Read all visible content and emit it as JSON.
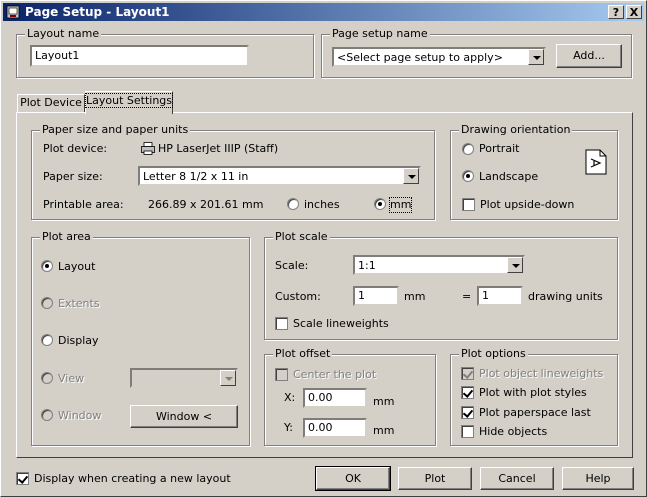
{
  "titlebar": {
    "title": "Page Setup - Layout1",
    "help_glyph": "?",
    "close_glyph": "X"
  },
  "layout_name": {
    "label": "Layout name",
    "value": "Layout1"
  },
  "page_setup_name": {
    "label": "Page setup name",
    "value": "<Select page setup to apply>",
    "add_button": "Add..."
  },
  "tabs": {
    "plot_device": "Plot Device",
    "layout_settings": "Layout Settings"
  },
  "paper": {
    "group_label": "Paper size and paper units",
    "plot_device_label": "Plot device:",
    "plot_device_value": "HP LaserJet IIIP (Staff)",
    "paper_size_label": "Paper size:",
    "paper_size_value": "Letter 8 1/2 x 11 in",
    "printable_area_label": "Printable area:",
    "printable_area_value": "266.89 x 201.61 mm",
    "inches_label": "inches",
    "mm_label": "mm"
  },
  "orientation": {
    "group_label": "Drawing orientation",
    "portrait": "Portrait",
    "landscape": "Landscape",
    "upside_down": "Plot upside-down"
  },
  "plot_area": {
    "group_label": "Plot area",
    "layout": "Layout",
    "extents": "Extents",
    "display": "Display",
    "view": "View",
    "window": "Window",
    "window_button": "Window <"
  },
  "plot_scale": {
    "group_label": "Plot scale",
    "scale_label": "Scale:",
    "scale_value": "1:1",
    "custom_label": "Custom:",
    "custom_value1": "1",
    "unit1": "mm",
    "equals": "=",
    "custom_value2": "1",
    "unit2": "drawing units",
    "scale_lineweights": "Scale lineweights"
  },
  "plot_offset": {
    "group_label": "Plot offset",
    "center": "Center the plot",
    "x_label": "X:",
    "x_value": "0.00",
    "y_label": "Y:",
    "y_value": "0.00",
    "unit": "mm"
  },
  "plot_options": {
    "group_label": "Plot options",
    "object_lineweights": "Plot object lineweights",
    "plot_styles": "Plot with plot styles",
    "paperspace_last": "Plot paperspace last",
    "hide_objects": "Hide objects"
  },
  "footer": {
    "display_new_layout": "Display when creating a new layout",
    "ok": "OK",
    "plot": "Plot",
    "cancel": "Cancel",
    "help": "Help"
  }
}
